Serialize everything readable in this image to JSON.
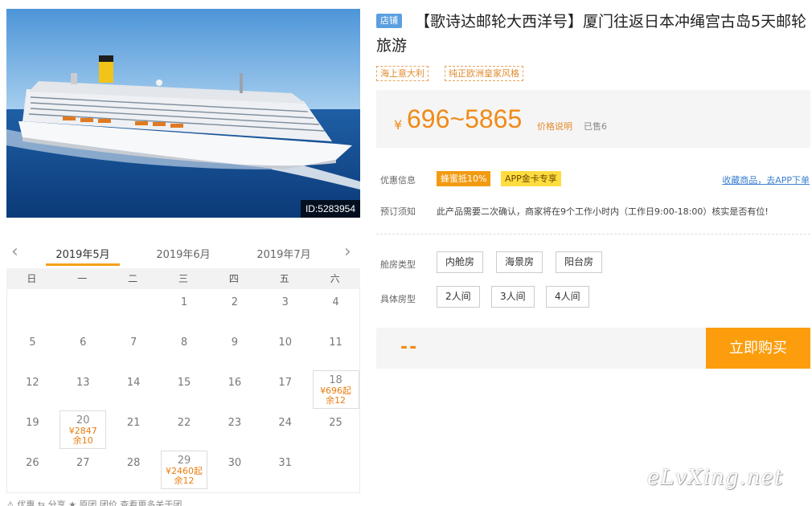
{
  "photo": {
    "id_label": "ID:5283954"
  },
  "calendar": {
    "months": [
      "2019年5月",
      "2019年6月",
      "2019年7月"
    ],
    "active_month_index": 0,
    "weekdays": [
      "日",
      "一",
      "二",
      "三",
      "四",
      "五",
      "六"
    ],
    "first_weekday": 3,
    "days_in_month": 31,
    "available": {
      "18": {
        "price": "¥696起",
        "left": "余12"
      },
      "20": {
        "price": "¥2847",
        "left": "余10"
      },
      "29": {
        "price": "¥2460起",
        "left": "余12"
      }
    },
    "footer_text": "⚠ 优惠  ⇆ 分享        ★ 原团   团价 查看更多关于团"
  },
  "product": {
    "store_tag": "店铺",
    "title": "【歌诗达邮轮大西洋号】厦门往返日本冲绳宫古岛5天邮轮旅游",
    "features": [
      "海上意大利",
      "纯正欧洲皇家风格"
    ],
    "price_currency": "¥",
    "price_range": "696~5865",
    "price_note": "价格说明",
    "sold": "已售6",
    "promo_label": "优惠信息",
    "promo_badges": [
      "蜂蜜抵10%",
      "APP金卡专享"
    ],
    "favorite_link": "收藏商品，去APP下单",
    "notice_label": "预订须知",
    "notice_text": "此产品需要二次确认，商家将在9个工作小时内（工作日9:00-18:00）核实是否有位!",
    "cabin_type_label": "舱房类型",
    "cabin_types": [
      "内舱房",
      "海景房",
      "阳台房"
    ],
    "room_type_label": "具体房型",
    "room_types": [
      "2人间",
      "3人间",
      "4人间"
    ],
    "total_placeholder": "--",
    "buy_label": "立即购买"
  },
  "watermark": "eLvXing.net",
  "colors": {
    "accent": "#f18a17",
    "buy": "#fb9d0d",
    "store_tag": "#5b9fe0",
    "link": "#3d7fcf"
  }
}
